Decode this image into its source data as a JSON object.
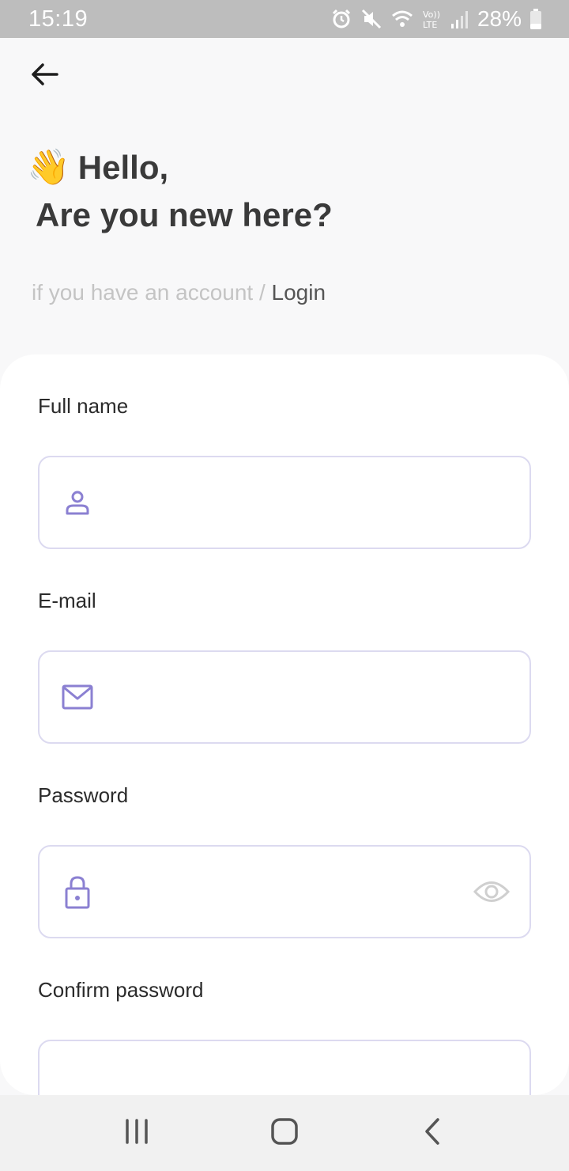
{
  "status_bar": {
    "time": "15:19",
    "battery_percent": "28%",
    "icons": [
      "alarm-icon",
      "mute-icon",
      "wifi-icon",
      "volte-icon",
      "signal-icon",
      "battery-icon"
    ]
  },
  "header": {
    "back_icon": "arrow-left-icon",
    "wave_emoji": "👋",
    "hello": "Hello,",
    "subheading": "Are you new here?",
    "account_prompt": "if you have an account / ",
    "login_link": "Login"
  },
  "form": {
    "full_name": {
      "label": "Full name",
      "value": "",
      "icon": "user-icon"
    },
    "email": {
      "label": "E-mail",
      "value": "",
      "icon": "mail-icon"
    },
    "password": {
      "label": "Password",
      "value": "",
      "icon": "lock-icon",
      "toggle_icon": "eye-icon"
    },
    "confirm_password": {
      "label": "Confirm password",
      "value": ""
    }
  },
  "nav_bar": {
    "items": [
      "recent-apps-icon",
      "home-icon",
      "back-nav-icon"
    ]
  },
  "colors": {
    "accent": "#8b80d2",
    "field_border": "#dcdaf0",
    "status_bar": "#bdbdbd"
  }
}
